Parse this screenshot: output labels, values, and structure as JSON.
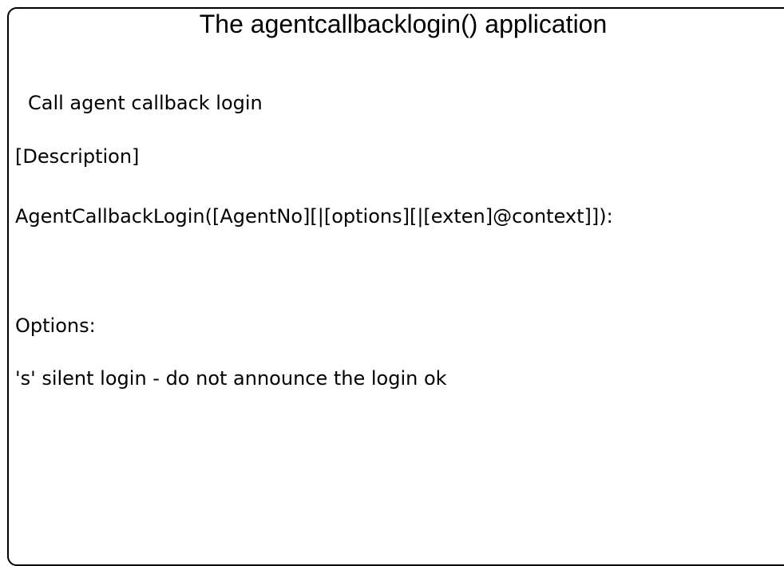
{
  "document": {
    "title": "The agentcallbacklogin() application",
    "summary": "Call agent callback login",
    "description_label": "[Description]",
    "syntax": "AgentCallbackLogin([AgentNo][|[options][|[exten]@context]]):",
    "options_label": "Options:",
    "option_s": "'s' silent login - do not announce the login ok"
  }
}
